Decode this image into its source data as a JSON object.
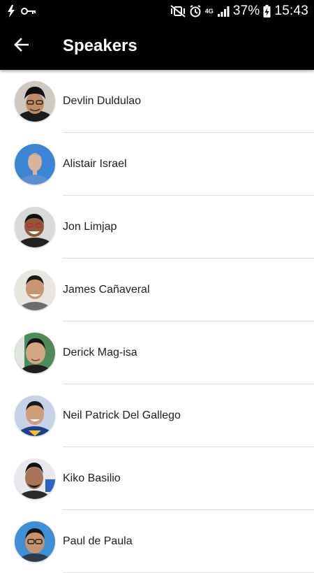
{
  "status_bar": {
    "battery_percent": "37%",
    "time": "15:43",
    "network_type": "4G",
    "icons": [
      "flash-icon",
      "key-icon",
      "mute-vibrate-icon",
      "alarm-icon",
      "signal-icon",
      "battery-charging-icon"
    ]
  },
  "app_bar": {
    "title": "Speakers",
    "back_icon": "arrow-left-icon"
  },
  "speakers": [
    {
      "name": "Devlin Duldulao",
      "avatar_bg": "#cfc9c0"
    },
    {
      "name": "Alistair Israel",
      "avatar_bg": "#3a86d4"
    },
    {
      "name": "Jon Limjap",
      "avatar_bg": "#d9d9d9"
    },
    {
      "name": "James Cañaveral",
      "avatar_bg": "#e9e6e0"
    },
    {
      "name": "Derick Mag-isa",
      "avatar_bg": "#4f8a5a"
    },
    {
      "name": "Neil Patrick Del Gallego",
      "avatar_bg": "#c6d3e6"
    },
    {
      "name": "Kiko Basilio",
      "avatar_bg": "#e8e8ee"
    },
    {
      "name": "Paul de Paula",
      "avatar_bg": "#3f8fd8"
    }
  ],
  "colors": {
    "app_bar": "#000000",
    "status_bar": "#000000",
    "divider": "#dcdcdc",
    "text": "#212121"
  }
}
